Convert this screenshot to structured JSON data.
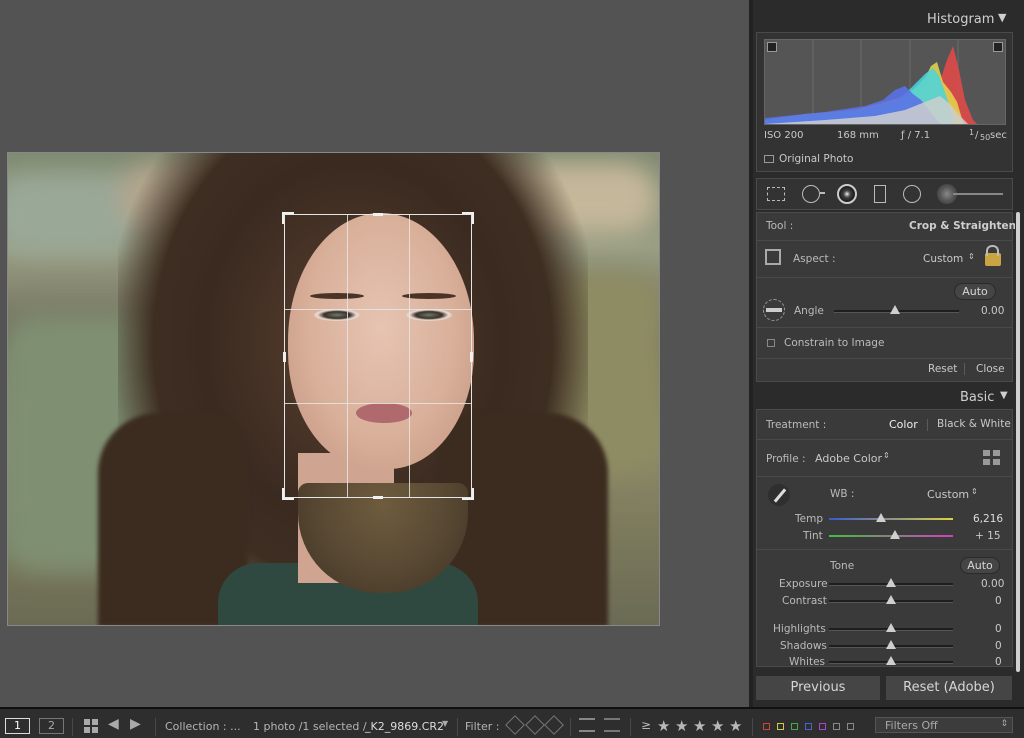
{
  "histogram": {
    "title": "Histogram",
    "iso": "ISO 200",
    "focal": "168 mm",
    "aperture": "ƒ / 7.1",
    "shutter_num": "1",
    "shutter_den": "50",
    "shutter_unit": "sec",
    "original_label": "Original Photo"
  },
  "crop": {
    "tool_label": "Tool :",
    "tool_value": "Crop & Straighten",
    "aspect_label": "Aspect :",
    "aspect_value": "Custom",
    "auto_label": "Auto",
    "angle_label": "Angle",
    "angle_value": "0.00",
    "angle_pos": 0.5,
    "constrain_label": "Constrain to Image",
    "reset_label": "Reset",
    "close_label": "Close"
  },
  "basic": {
    "title": "Basic",
    "treatment_label": "Treatment :",
    "color_label": "Color",
    "bw_label": "Black & White",
    "profile_label": "Profile :",
    "profile_value": "Adobe Color",
    "wb_label": "WB :",
    "wb_value": "Custom",
    "temp_label": "Temp",
    "temp_value": "6,216",
    "temp_pos": 0.42,
    "tint_label": "Tint",
    "tint_value": "+ 15",
    "tint_pos": 0.53,
    "tone_label": "Tone",
    "tone_auto": "Auto",
    "sliders": [
      {
        "label": "Exposure",
        "value": "0.00",
        "pos": 0.5
      },
      {
        "label": "Contrast",
        "value": "0",
        "pos": 0.5
      },
      {
        "label": "Highlights",
        "value": "0",
        "pos": 0.5
      },
      {
        "label": "Shadows",
        "value": "0",
        "pos": 0.5
      },
      {
        "label": "Whites",
        "value": "0",
        "pos": 0.5
      }
    ]
  },
  "buttons": {
    "previous": "Previous",
    "reset": "Reset (Adobe)"
  },
  "filmstrip": {
    "view1": "1",
    "view2": "2",
    "collection": "Collection : ...",
    "selection": "1 photo /1 selected /",
    "filename": "_K2_9869.CR2",
    "filter_label": "Filter :",
    "rating_op": "≥",
    "stars": [
      "★",
      "★",
      "★",
      "★",
      "★"
    ],
    "filters_off": "Filters Off"
  },
  "colors": {
    "red": "#e04a4a",
    "yellow": "#e6d84a",
    "green": "#5bd16a",
    "cyan": "#48d6e0",
    "blue": "#5a72e6",
    "magenta": "#c05ad0"
  }
}
